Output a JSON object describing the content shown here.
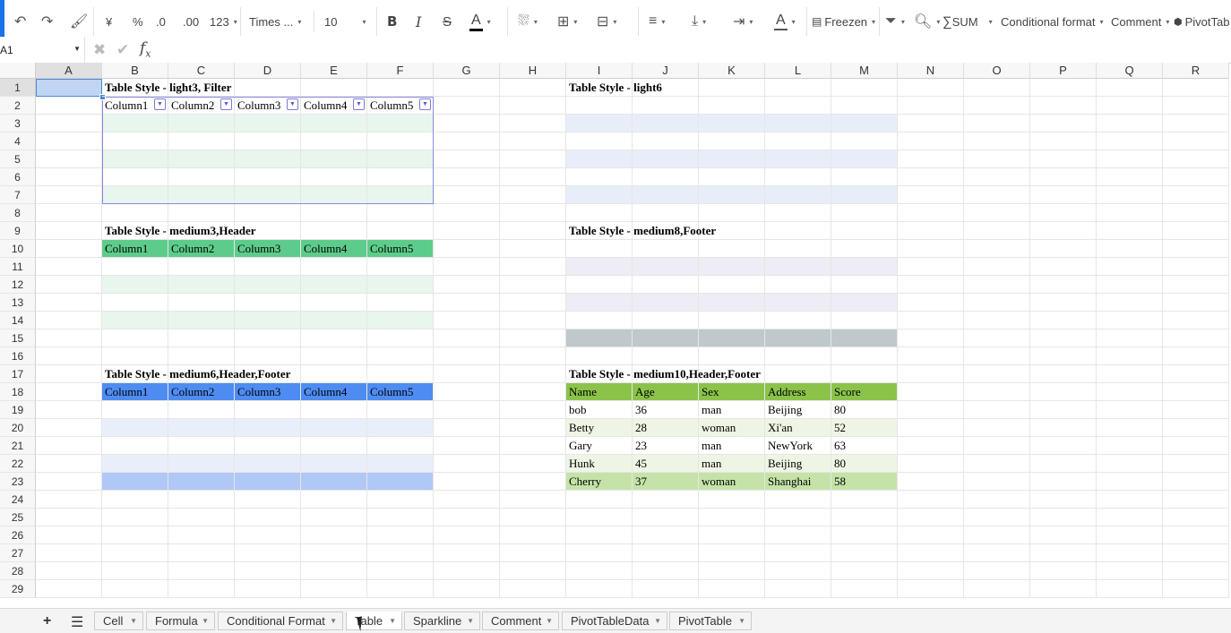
{
  "toolbar": {
    "font_name": "Times ...",
    "font_size": "10",
    "currency": "¥",
    "percent": "%",
    "decrease_decimal": ".0",
    "increase_decimal": ".00",
    "number_format": "123",
    "bold": "B",
    "italic": "I",
    "strike": "S",
    "font_color": "A",
    "text_color_2": "A",
    "freeze": "Freezen",
    "sum": "SUM",
    "conditional_format": "Conditional format",
    "comment": "Comment",
    "pivot": "PivotTab",
    "accent_color": "#1a73e8"
  },
  "formula_bar": {
    "cell_ref": "A1",
    "fx": "f",
    "fx_sub": "x",
    "value": ""
  },
  "columns": [
    "A",
    "B",
    "C",
    "D",
    "E",
    "F",
    "G",
    "H",
    "I",
    "J",
    "K",
    "L",
    "M",
    "N",
    "O",
    "P",
    "Q",
    "R"
  ],
  "rows": [
    "1",
    "2",
    "3",
    "4",
    "5",
    "6",
    "7",
    "8",
    "9",
    "10",
    "11",
    "12",
    "13",
    "14",
    "15",
    "16",
    "17",
    "18",
    "19",
    "20",
    "21",
    "22",
    "23",
    "24",
    "25",
    "26",
    "27",
    "28",
    "29"
  ],
  "tables": {
    "t1": {
      "title": "Table Style - light3, Filter",
      "headers": [
        "Column1",
        "Column2",
        "Column3",
        "Column4",
        "Column5"
      ],
      "header_color": "#ffffff",
      "band_color": "#e8f6ed"
    },
    "t2": {
      "title": "Table Style - light6",
      "band_color": "#e8eef9"
    },
    "t3": {
      "title": "Table Style - medium3,Header",
      "headers": [
        "Column1",
        "Column2",
        "Column3",
        "Column4",
        "Column5"
      ],
      "header_color": "#5dcc8a",
      "band_color": "#e8f6ed"
    },
    "t4": {
      "title": "Table Style - medium8,Footer",
      "band_color": "#eeedf5",
      "footer_color": "#bfc9cc"
    },
    "t5": {
      "title": "Table Style - medium6,Header,Footer",
      "headers": [
        "Column1",
        "Column2",
        "Column3",
        "Column4",
        "Column5"
      ],
      "header_color": "#4e8cf2",
      "band_color": "#e9effa",
      "footer_color": "#b0c8f5"
    },
    "t6": {
      "title": "Table Style - medium10,Header,Footer",
      "headers": [
        "Name",
        "Age",
        "Sex",
        "Address",
        "Score"
      ],
      "rows": [
        [
          "bob",
          "36",
          "man",
          "Beijing",
          "80"
        ],
        [
          "Betty",
          "28",
          "woman",
          "Xi'an",
          "52"
        ],
        [
          "Gary",
          "23",
          "man",
          "NewYork",
          "63"
        ],
        [
          "Hunk",
          "45",
          "man",
          "Beijing",
          "80"
        ],
        [
          "Cherry",
          "37",
          "woman",
          "Shanghai",
          "58"
        ]
      ],
      "header_color": "#8bc34a",
      "band_color": "#eef5e4",
      "footer_color": "#c5e3a8"
    }
  },
  "sheet_tabs": [
    "Cell",
    "Formula",
    "Conditional Format",
    "Table",
    "Sparkline",
    "Comment",
    "PivotTableData",
    "PivotTable"
  ],
  "active_tab": "Table"
}
